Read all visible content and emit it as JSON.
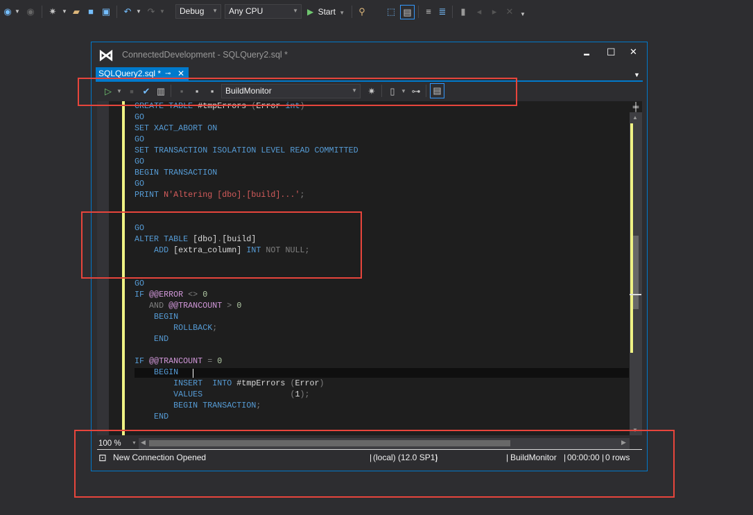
{
  "main_toolbar": {
    "config": "Debug",
    "platform": "Any CPU",
    "start_label": "Start",
    "icons": [
      "back-icon",
      "forward-icon",
      "new-project-icon",
      "open-icon",
      "save-icon",
      "save-all-icon",
      "undo-icon",
      "redo-icon",
      "find-icon",
      "select-icon",
      "solution-explorer-icon",
      "comment-icon",
      "uncomment-icon",
      "bookmark-icon",
      "prev-bookmark-icon",
      "next-bookmark-icon",
      "clear-bookmark-icon"
    ]
  },
  "window": {
    "title": "ConnectedDevelopment - SQLQuery2.sql *",
    "tab_label": "SQLQuery2.sql *",
    "minimize": "▬",
    "maximize": "☐",
    "close": "✕"
  },
  "query_toolbar": {
    "database": "BuildMonitor"
  },
  "code_lines": [
    [
      [
        "CREATE TABLE ",
        "k"
      ],
      [
        "#tmpErrors ",
        "i"
      ],
      [
        "(",
        "g"
      ],
      [
        "Error ",
        "i"
      ],
      [
        "int",
        "k"
      ],
      [
        ")",
        "g"
      ]
    ],
    [
      [
        "GO",
        "k"
      ]
    ],
    [
      [
        "SET XACT_ABORT ON",
        "k"
      ]
    ],
    [
      [
        "GO",
        "k"
      ]
    ],
    [
      [
        "SET TRANSACTION ISOLATION LEVEL READ COMMITTED",
        "k"
      ]
    ],
    [
      [
        "GO",
        "k"
      ]
    ],
    [
      [
        "BEGIN TRANSACTION",
        "k"
      ]
    ],
    [
      [
        "GO",
        "k"
      ]
    ],
    [
      [
        "PRINT ",
        "k"
      ],
      [
        "N'Altering [dbo].[build]...'",
        "s"
      ],
      [
        ";",
        "g"
      ]
    ],
    [],
    [],
    [
      [
        "GO",
        "k"
      ]
    ],
    [
      [
        "ALTER TABLE ",
        "k"
      ],
      [
        "[dbo]",
        "i"
      ],
      [
        ".",
        "g"
      ],
      [
        "[build]",
        "i"
      ]
    ],
    [
      [
        "    ADD ",
        "k"
      ],
      [
        "[extra_column] ",
        "i"
      ],
      [
        "INT ",
        "k"
      ],
      [
        "NOT NULL",
        "g"
      ],
      [
        ";",
        "g"
      ]
    ],
    [],
    [],
    [
      [
        "GO",
        "k"
      ]
    ],
    [
      [
        "IF ",
        "k"
      ],
      [
        "@@ERROR ",
        "p"
      ],
      [
        "<> ",
        "g"
      ],
      [
        "0",
        "n"
      ]
    ],
    [
      [
        "   AND ",
        "g"
      ],
      [
        "@@TRANCOUNT ",
        "p"
      ],
      [
        "> ",
        "g"
      ],
      [
        "0",
        "n"
      ]
    ],
    [
      [
        "    BEGIN",
        "k"
      ]
    ],
    [
      [
        "        ROLLBACK",
        "k"
      ],
      [
        ";",
        "g"
      ]
    ],
    [
      [
        "    END",
        "k"
      ]
    ],
    [],
    [
      [
        "IF ",
        "k"
      ],
      [
        "@@TRANCOUNT ",
        "p"
      ],
      [
        "= ",
        "g"
      ],
      [
        "0",
        "n"
      ]
    ],
    [
      [
        "    BEGIN",
        "k"
      ]
    ],
    [
      [
        "        INSERT  INTO ",
        "k"
      ],
      [
        "#tmpErrors ",
        "i"
      ],
      [
        "(",
        "g"
      ],
      [
        "Error",
        "i"
      ],
      [
        ")",
        "g"
      ]
    ],
    [
      [
        "        VALUES                  ",
        "k"
      ],
      [
        "(",
        "g"
      ],
      [
        "1",
        "i"
      ],
      [
        ");",
        "g"
      ]
    ],
    [
      [
        "        BEGIN TRANSACTION",
        "k"
      ],
      [
        ";",
        "g"
      ]
    ],
    [
      [
        "    END",
        "k"
      ]
    ]
  ],
  "editor": {
    "zoom": "100 %"
  },
  "status_bar": {
    "message": "New Connection Opened",
    "server": "(local) (12.0 SP1)",
    "database": "BuildMonitor",
    "elapsed": "00:00:00",
    "rows": "0 rows"
  },
  "colors": {
    "accent": "#007acc",
    "annotation": "#e8453c",
    "change_bar": "#eff284"
  }
}
